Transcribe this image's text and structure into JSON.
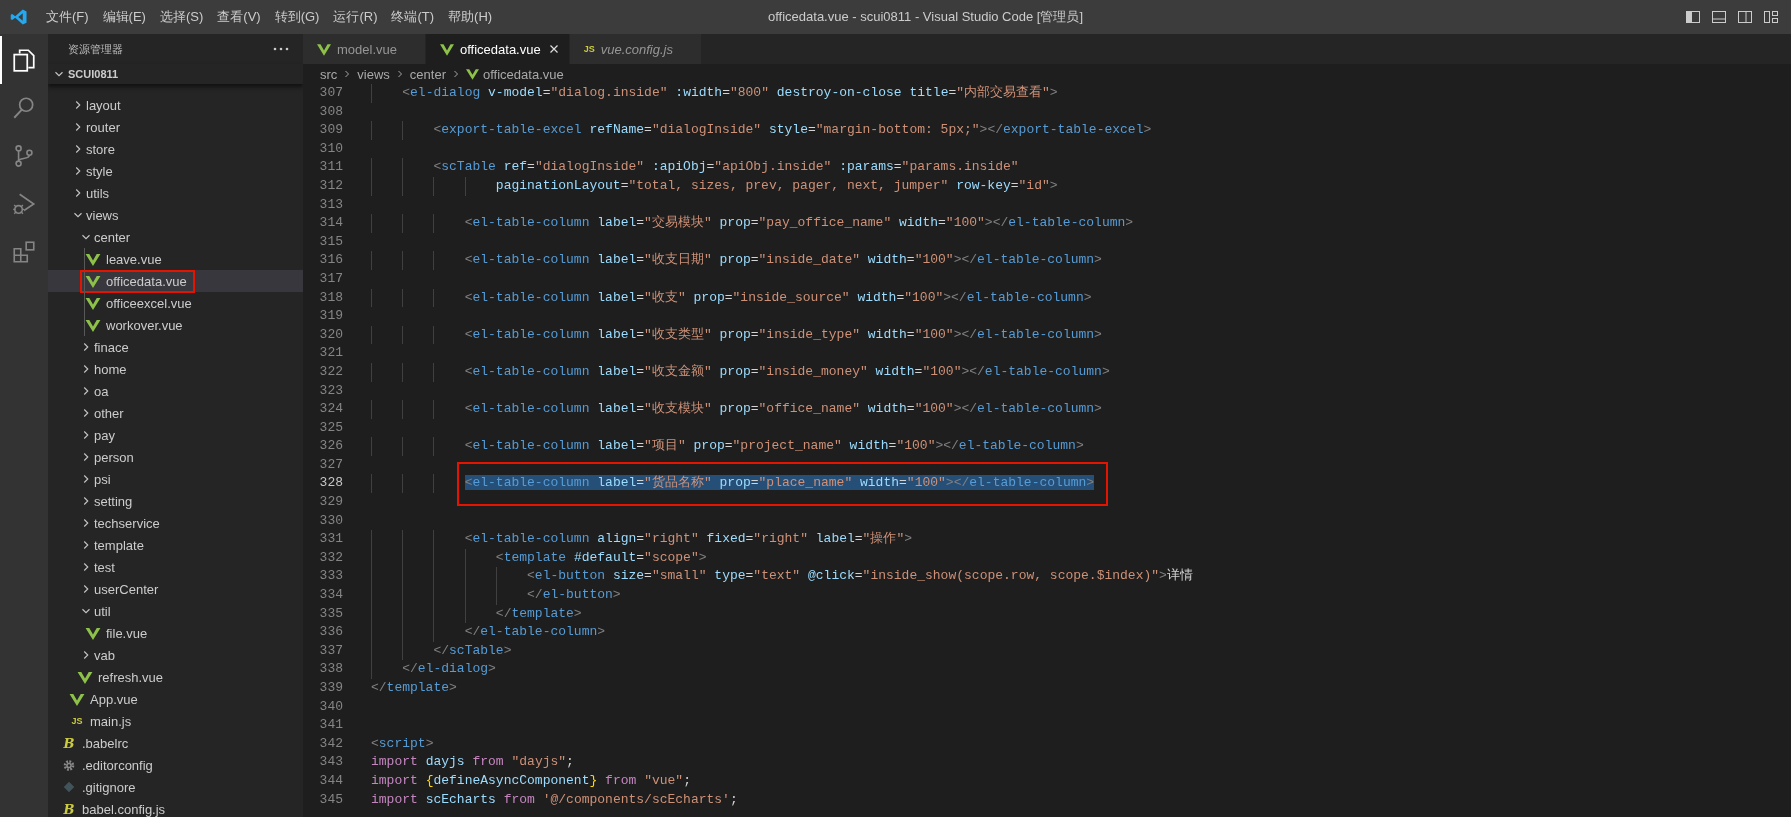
{
  "window": {
    "title": "officedata.vue - scui0811 - Visual Studio Code [管理员]"
  },
  "menu": [
    "文件(F)",
    "编辑(E)",
    "选择(S)",
    "查看(V)",
    "转到(G)",
    "运行(R)",
    "终端(T)",
    "帮助(H)"
  ],
  "explorer": {
    "title": "资源管理器",
    "root": {
      "name": "SCUI0811",
      "expanded": true
    },
    "folder_contents": [
      {
        "name": "layout",
        "kind": "folder",
        "expanded": false,
        "selected": false,
        "highlighted": false
      },
      {
        "name": "router",
        "kind": "folder",
        "expanded": false,
        "selected": false,
        "highlighted": false
      },
      {
        "name": "store",
        "kind": "folder",
        "expanded": false,
        "selected": false,
        "highlighted": false
      },
      {
        "name": "style",
        "kind": "folder",
        "expanded": false,
        "selected": false,
        "highlighted": false
      },
      {
        "name": "utils",
        "kind": "folder",
        "expanded": false,
        "selected": false,
        "highlighted": false
      },
      {
        "name": "views",
        "kind": "folder",
        "expanded": true,
        "selected": false,
        "highlighted": false,
        "children": [
          {
            "name": "center",
            "kind": "folder",
            "expanded": true,
            "selected": false,
            "highlighted": false,
            "children": [
              {
                "name": "leave.vue",
                "kind": "vue",
                "selected": false,
                "highlighted": false
              },
              {
                "name": "officedata.vue",
                "kind": "vue",
                "selected": true,
                "highlighted": true
              },
              {
                "name": "officeexcel.vue",
                "kind": "vue",
                "selected": false,
                "highlighted": false
              },
              {
                "name": "workover.vue",
                "kind": "vue",
                "selected": false,
                "highlighted": false
              }
            ]
          },
          {
            "name": "finace",
            "kind": "folder",
            "expanded": false,
            "selected": false,
            "highlighted": false
          },
          {
            "name": "home",
            "kind": "folder",
            "expanded": false,
            "selected": false,
            "highlighted": false
          },
          {
            "name": "oa",
            "kind": "folder",
            "expanded": false,
            "selected": false,
            "highlighted": false
          },
          {
            "name": "other",
            "kind": "folder",
            "expanded": false,
            "selected": false,
            "highlighted": false
          },
          {
            "name": "pay",
            "kind": "folder",
            "expanded": false,
            "selected": false,
            "highlighted": false
          },
          {
            "name": "person",
            "kind": "folder",
            "expanded": false,
            "selected": false,
            "highlighted": false
          },
          {
            "name": "psi",
            "kind": "folder",
            "expanded": false,
            "selected": false,
            "highlighted": false
          },
          {
            "name": "setting",
            "kind": "folder",
            "expanded": false,
            "selected": false,
            "highlighted": false
          },
          {
            "name": "techservice",
            "kind": "folder",
            "expanded": false,
            "selected": false,
            "highlighted": false
          },
          {
            "name": "template",
            "kind": "folder",
            "expanded": false,
            "selected": false,
            "highlighted": false
          },
          {
            "name": "test",
            "kind": "folder",
            "expanded": false,
            "selected": false,
            "highlighted": false
          },
          {
            "name": "userCenter",
            "kind": "folder",
            "expanded": false,
            "selected": false,
            "highlighted": false
          },
          {
            "name": "util",
            "kind": "folder",
            "expanded": true,
            "selected": false,
            "highlighted": false,
            "children": [
              {
                "name": "file.vue",
                "kind": "vue",
                "selected": false,
                "highlighted": false
              }
            ]
          },
          {
            "name": "vab",
            "kind": "folder",
            "expanded": false,
            "selected": false,
            "highlighted": false
          },
          {
            "name": "refresh.vue",
            "kind": "vue",
            "selected": false,
            "highlighted": false
          }
        ]
      },
      {
        "name": "App.vue",
        "kind": "vue",
        "selected": false,
        "highlighted": false
      },
      {
        "name": "main.js",
        "kind": "js",
        "badge": "JS",
        "selected": false,
        "highlighted": false
      }
    ],
    "root_entries": [
      {
        "name": ".babelrc",
        "kind": "babel",
        "badge": "B",
        "selected": false,
        "highlighted": false
      },
      {
        "name": ".editorconfig",
        "kind": "config",
        "selected": false,
        "highlighted": false
      },
      {
        "name": ".gitignore",
        "kind": "git",
        "selected": false,
        "highlighted": false
      },
      {
        "name": "babel.config.js",
        "kind": "babel",
        "badge": "B",
        "selected": false,
        "highlighted": false
      }
    ]
  },
  "tabs": [
    {
      "label": "model.vue",
      "kind": "vue",
      "selected": false,
      "preview": false
    },
    {
      "label": "officedata.vue",
      "kind": "vue",
      "selected": true,
      "preview": false
    },
    {
      "label": "vue.config.js",
      "kind": "js",
      "badge": "JS",
      "selected": false,
      "preview": true
    }
  ],
  "breadcrumb": [
    {
      "label": "src",
      "kind": "folder"
    },
    {
      "label": "views",
      "kind": "folder"
    },
    {
      "label": "center",
      "kind": "folder"
    },
    {
      "label": "officedata.vue",
      "kind": "vue"
    }
  ],
  "code": {
    "lines": [
      {
        "num": "307",
        "selected": false,
        "highlighted": false,
        "text": "    <el-dialog v-model=\"dialog.inside\" :width=\"800\" destroy-on-close title=\"内部交易查看\">"
      },
      {
        "num": "308",
        "selected": false,
        "highlighted": false
      },
      {
        "num": "309",
        "selected": false,
        "highlighted": false,
        "text": "        <export-table-excel refName=\"dialogInside\" style=\"margin-bottom: 5px;\"></export-table-excel>"
      },
      {
        "num": "310",
        "selected": false,
        "highlighted": false
      },
      {
        "num": "311",
        "selected": false,
        "highlighted": false,
        "text": "        <scTable ref=\"dialogInside\" :apiObj=\"apiObj.inside\" :params=\"params.inside\""
      },
      {
        "num": "312",
        "selected": false,
        "highlighted": false,
        "text": "                paginationLayout=\"total, sizes, prev, pager, next, jumper\" row-key=\"id\">"
      },
      {
        "num": "313",
        "selected": false,
        "highlighted": false
      },
      {
        "num": "314",
        "selected": false,
        "highlighted": false,
        "text": "            <el-table-column label=\"交易模块\" prop=\"pay_office_name\" width=\"100\"></el-table-column>"
      },
      {
        "num": "315",
        "selected": false,
        "highlighted": false
      },
      {
        "num": "316",
        "selected": false,
        "highlighted": false,
        "text": "            <el-table-column label=\"收支日期\" prop=\"inside_date\" width=\"100\"></el-table-column>"
      },
      {
        "num": "317",
        "selected": false,
        "highlighted": false
      },
      {
        "num": "318",
        "selected": false,
        "highlighted": false,
        "text": "            <el-table-column label=\"收支\" prop=\"inside_source\" width=\"100\"></el-table-column>"
      },
      {
        "num": "319",
        "selected": false,
        "highlighted": false
      },
      {
        "num": "320",
        "selected": false,
        "highlighted": false,
        "text": "            <el-table-column label=\"收支类型\" prop=\"inside_type\" width=\"100\"></el-table-column>"
      },
      {
        "num": "321",
        "selected": false,
        "highlighted": false
      },
      {
        "num": "322",
        "selected": false,
        "highlighted": false,
        "text": "            <el-table-column label=\"收支金额\" prop=\"inside_money\" width=\"100\"></el-table-column>"
      },
      {
        "num": "323",
        "selected": false,
        "highlighted": false
      },
      {
        "num": "324",
        "selected": false,
        "highlighted": false,
        "text": "            <el-table-column label=\"收支模块\" prop=\"office_name\" width=\"100\"></el-table-column>"
      },
      {
        "num": "325",
        "selected": false,
        "highlighted": false
      },
      {
        "num": "326",
        "selected": false,
        "highlighted": false,
        "text": "            <el-table-column label=\"项目\" prop=\"project_name\" width=\"100\"></el-table-column>"
      },
      {
        "num": "327",
        "selected": false,
        "highlighted": false
      },
      {
        "num": "328",
        "selected": true,
        "highlighted": true,
        "text": "            <el-table-column label=\"货品名称\" prop=\"place_name\" width=\"100\"></el-table-column>"
      },
      {
        "num": "329",
        "selected": false,
        "highlighted": false
      },
      {
        "num": "330",
        "selected": false,
        "highlighted": false
      },
      {
        "num": "331",
        "selected": false,
        "highlighted": false,
        "text": "            <el-table-column align=\"right\" fixed=\"right\" label=\"操作\">"
      },
      {
        "num": "332",
        "selected": false,
        "highlighted": false,
        "text": "                <template #default=\"scope\">"
      },
      {
        "num": "333",
        "selected": false,
        "highlighted": false,
        "text": "                    <el-button size=\"small\" type=\"text\" @click=\"inside_show(scope.row, scope.$index)\">详情"
      },
      {
        "num": "334",
        "selected": false,
        "highlighted": false,
        "text": "                    </el-button>"
      },
      {
        "num": "335",
        "selected": false,
        "highlighted": false,
        "text": "                </template>"
      },
      {
        "num": "336",
        "selected": false,
        "highlighted": false,
        "text": "            </el-table-column>"
      },
      {
        "num": "337",
        "selected": false,
        "highlighted": false,
        "text": "        </scTable>"
      },
      {
        "num": "338",
        "selected": false,
        "highlighted": false,
        "text": "    </el-dialog>"
      },
      {
        "num": "339",
        "selected": false,
        "highlighted": false,
        "text": "</template>"
      },
      {
        "num": "340",
        "selected": false,
        "highlighted": false
      },
      {
        "num": "341",
        "selected": false,
        "highlighted": false
      },
      {
        "num": "342",
        "selected": false,
        "highlighted": false,
        "text": "<script>"
      },
      {
        "num": "343",
        "selected": false,
        "highlighted": false,
        "text": "import dayjs from \"dayjs\";"
      },
      {
        "num": "344",
        "selected": false,
        "highlighted": false,
        "text": "import {defineAsyncComponent} from \"vue\";"
      },
      {
        "num": "345",
        "selected": false,
        "highlighted": false,
        "text": "import scEcharts from '@/components/scEcharts';"
      }
    ]
  }
}
